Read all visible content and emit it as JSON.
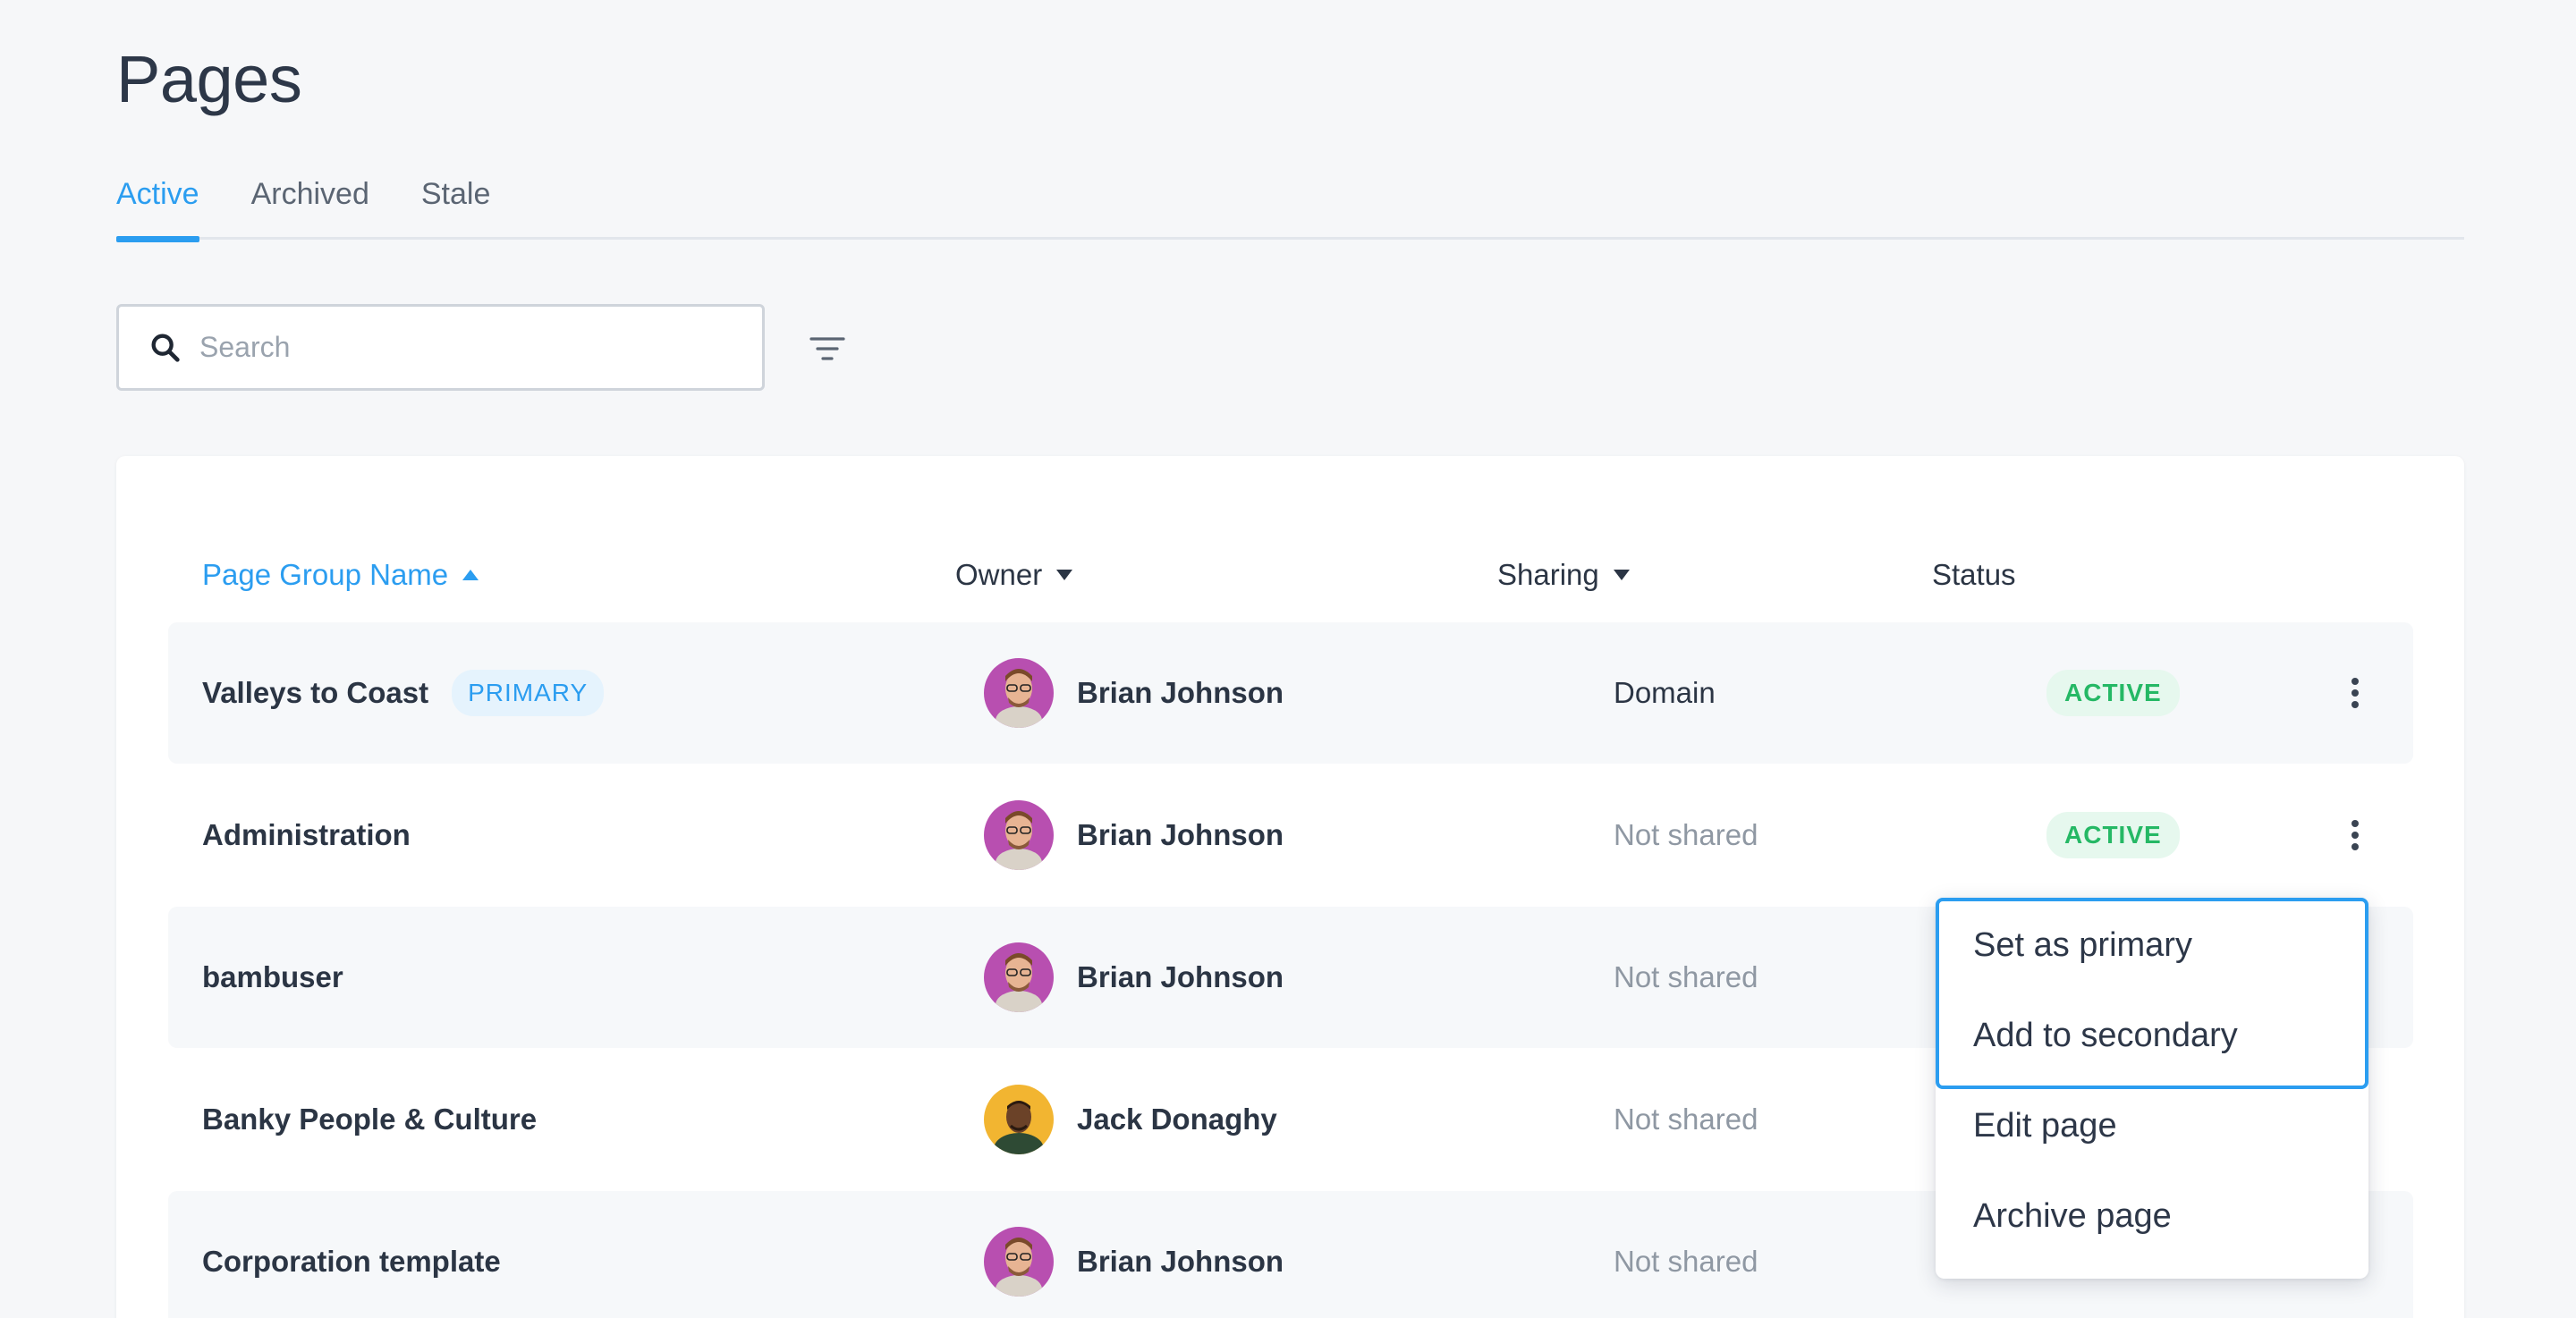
{
  "header": {
    "title": "Pages"
  },
  "tabs": [
    {
      "label": "Active",
      "active": true
    },
    {
      "label": "Archived",
      "active": false
    },
    {
      "label": "Stale",
      "active": false
    }
  ],
  "search": {
    "placeholder": "Search",
    "value": ""
  },
  "icons": {
    "search": "search-icon",
    "filter": "filter-icon",
    "more": "more-vertical-icon"
  },
  "colors": {
    "accent": "#2b9df0",
    "active_badge": "#25b865",
    "primary_badge_bg": "#e5f3fd"
  },
  "table": {
    "columns": {
      "name": "Page Group Name",
      "owner": "Owner",
      "sharing": "Sharing",
      "status": "Status"
    },
    "rows": [
      {
        "name": "Valleys to Coast",
        "badge": "PRIMARY",
        "owner": "Brian Johnson",
        "sharing": "Domain",
        "status": "ACTIVE"
      },
      {
        "name": "Administration",
        "badge": "",
        "owner": "Brian Johnson",
        "sharing": "Not shared",
        "status": "ACTIVE"
      },
      {
        "name": "bambuser",
        "badge": "",
        "owner": "Brian Johnson",
        "sharing": "Not shared",
        "status": ""
      },
      {
        "name": "Banky People & Culture",
        "badge": "",
        "owner": "Jack Donaghy",
        "sharing": "Not shared",
        "status": ""
      },
      {
        "name": "Corporation template",
        "badge": "",
        "owner": "Brian Johnson",
        "sharing": "Not shared",
        "status": ""
      }
    ]
  },
  "menu": {
    "items": [
      "Set as primary",
      "Add to secondary",
      "Edit page",
      "Archive page"
    ]
  }
}
